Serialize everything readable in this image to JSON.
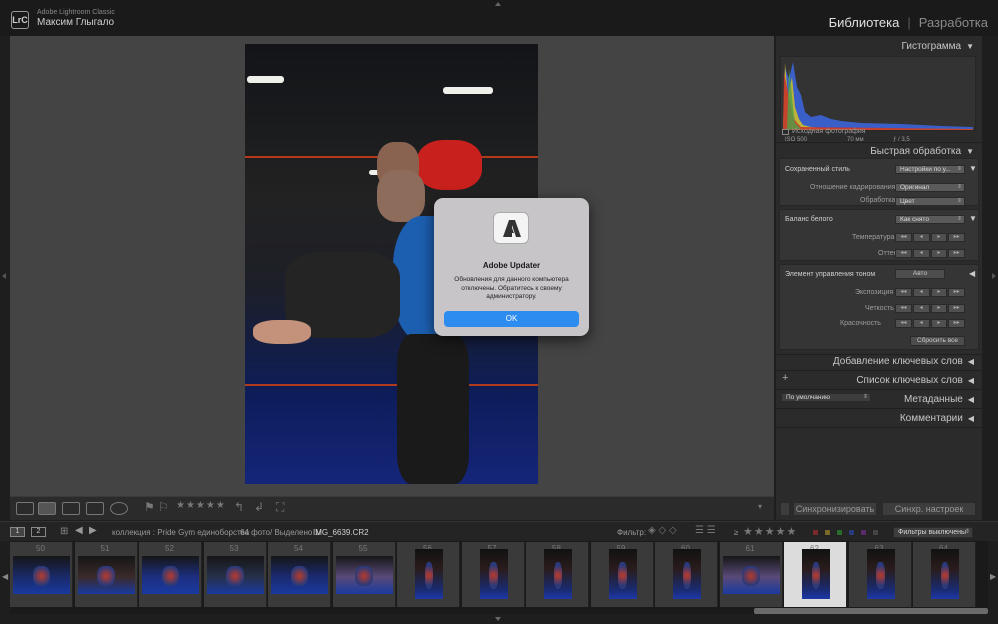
{
  "app": {
    "name": "Adobe Lightroom Classic",
    "user": "Максим Глыгало",
    "logo_text": "LrC"
  },
  "modules": {
    "active": "Библиотека",
    "separator": "|",
    "inactive": "Разработка"
  },
  "right_panel": {
    "histogram": {
      "title": "Гистограмма",
      "iso": "ISO 500",
      "focal": "70 мм",
      "aperture": "ƒ / 3,5",
      "original_label": "Исходная фотография"
    },
    "quick_develop": {
      "title": "Быстрая обработка",
      "saved_preset_label": "Сохраненный стиль",
      "saved_preset_value": "Настройки по у...",
      "crop_label": "Отношение кадрирования",
      "crop_value": "Оригинал",
      "treatment_label": "Обработка",
      "treatment_value": "Цвет",
      "wb_label": "Баланс белого",
      "wb_value": "Как снято",
      "temp_label": "Температура",
      "tint_label": "Оттенок",
      "tone_label": "Элемент управления тоном",
      "auto_label": "Авто",
      "exposure_label": "Экспозиция",
      "clarity_label": "Четкость",
      "vibrance_label": "Красочность",
      "reset_label": "Сбросить все"
    },
    "keywording": {
      "title": "Добавление ключевых слов"
    },
    "keyword_list": {
      "title": "Список ключевых слов",
      "plus": "+"
    },
    "metadata": {
      "title": "Метаданные",
      "preset": "По умолчанию"
    },
    "comments": {
      "title": "Комментарии"
    },
    "sync_button": "Синхронизировать",
    "sync_settings_button": "Синхр. настроек"
  },
  "filmstrip_bar": {
    "page1": "1",
    "page2": "2",
    "source": "коллекция : Pride Gym единоборства",
    "count": "64 фото/ Выделено 1/",
    "filename": "IMG_6639.CR2",
    "filter_label": "Фильтр:",
    "filter_value": "Фильтры выключены",
    "stars": "★★★★★",
    "ge_symbol": "≥"
  },
  "toolbar": {
    "stars": "★★★★★"
  },
  "filmstrip": {
    "frames": [
      {
        "num": "50",
        "orientation": "landscape"
      },
      {
        "num": "51",
        "orientation": "landscape"
      },
      {
        "num": "52",
        "orientation": "landscape"
      },
      {
        "num": "53",
        "orientation": "landscape"
      },
      {
        "num": "54",
        "orientation": "landscape"
      },
      {
        "num": "55",
        "orientation": "landscape"
      },
      {
        "num": "56",
        "orientation": "portrait"
      },
      {
        "num": "57",
        "orientation": "portrait"
      },
      {
        "num": "58",
        "orientation": "portrait"
      },
      {
        "num": "59",
        "orientation": "portrait"
      },
      {
        "num": "60",
        "orientation": "portrait"
      },
      {
        "num": "61",
        "orientation": "landscape"
      },
      {
        "num": "62",
        "orientation": "portrait",
        "selected": true
      },
      {
        "num": "63",
        "orientation": "portrait"
      },
      {
        "num": "64",
        "orientation": "portrait"
      }
    ]
  },
  "dialog": {
    "title": "Adobe Updater",
    "message": "Обновления для данного компьютера отключены. Обратитесь к своему администратору.",
    "ok": "OK"
  },
  "colors": {
    "accent": "#2d8cf0",
    "background": "#1e1e1e",
    "panel": "#2b2b2b"
  }
}
